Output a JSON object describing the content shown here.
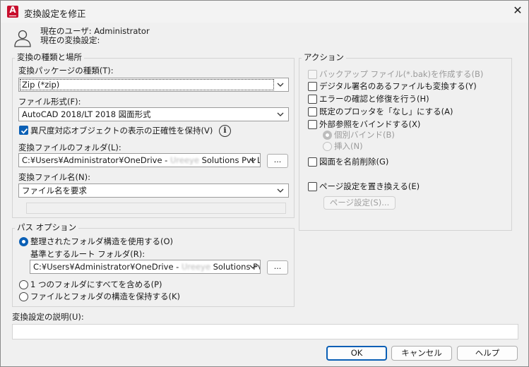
{
  "window": {
    "title": "変換設定を修正",
    "close_glyph": "✕"
  },
  "user": {
    "current_user": "現在のユーザ: Administrator",
    "current_setting": "現在の変換設定:"
  },
  "transmittal_group": {
    "legend": "変換の種類と場所",
    "package_type_label": "変換パッケージの種類(T):",
    "package_type_value": "Zip (*zip)",
    "file_format_label": "ファイル形式(F):",
    "file_format_value": "AutoCAD 2018/LT 2018 図面形式",
    "annotative_label": "異尺度対応オブジェクトの表示の正確性を保持(V)",
    "folder_label": "変換ファイルのフォルダ(L):",
    "folder_value_pre": "C:¥Users¥Administrator¥OneDrive - ",
    "folder_value_blur": "Ureeye",
    "folder_value_post": " Solutions Pvt Ltd",
    "browse_label": "...",
    "filename_label": "変換ファイル名(N):",
    "filename_value": "ファイル名を要求"
  },
  "path_group": {
    "legend": "パス オプション",
    "organized_label": "整理されたフォルダ構造を使用する(O)",
    "root_folder_label": "基準とするルート フォルダ(R):",
    "root_folder_pre": "C:¥Users¥Administrator¥OneDrive - ",
    "root_folder_blur": "Ureeye",
    "root_folder_post": " Solutions Pvt",
    "browse_label": "...",
    "single_folder_label": "1 つのフォルダにすべてを含める(P)",
    "keep_structure_label": "ファイルとフォルダの構造を保持する(K)"
  },
  "actions_group": {
    "legend": "アクション",
    "backup_label": "バックアップ ファイル(*.bak)を作成する(B)",
    "digital_sig_label": "デジタル署名のあるファイルも変換する(Y)",
    "audit_label": "エラーの確認と修復を行う(H)",
    "plotter_none_label": "既定のプロッタを「なし」にする(A)",
    "bind_xref_label": "外部参照をバインドする(X)",
    "bind_label": "個別バインド(B)",
    "insert_label": "挿入(N)",
    "purge_label": "図面を名前削除(G)",
    "replace_pagesetup_label": "ページ設定を置き換える(E)",
    "pagesetup_button": "ページ設定(S)..."
  },
  "description": {
    "label": "変換設定の説明(U):",
    "value": ""
  },
  "buttons": {
    "ok": "OK",
    "cancel": "キャンセル",
    "help": "ヘルプ"
  },
  "colors": {
    "accent": "#0a5fb5",
    "app_icon": "#c8102e"
  },
  "icons": [
    "autocad-app-icon",
    "close-icon",
    "user-icon",
    "chevron-down-icon",
    "info-icon",
    "checkmark-icon"
  ]
}
